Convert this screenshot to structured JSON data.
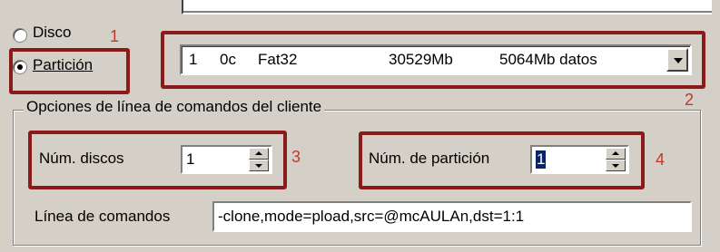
{
  "source_selector": {
    "disk_label": "Disco",
    "partition_label": "Partición",
    "selected": "partition"
  },
  "partition_combo": {
    "index": "1",
    "type_code": "0c",
    "fs": "Fat32",
    "size": "30529Mb",
    "data": "5064Mb datos"
  },
  "client_options": {
    "group_title": "Opciones de línea de comandos del cliente",
    "num_disks_label": "Núm. discos",
    "num_disks_value": "1",
    "partition_num_label": "Núm. de partición",
    "partition_num_value": "1",
    "command_line_label": "Línea de comandos",
    "command_line_value": "-clone,mode=pload,src=@mcAULAn,dst=1:1"
  },
  "annotations": {
    "n1": "1",
    "n2": "2",
    "n3": "3",
    "n4": "4",
    "color": "#8b1a1a",
    "number_color": "#c0392b"
  }
}
